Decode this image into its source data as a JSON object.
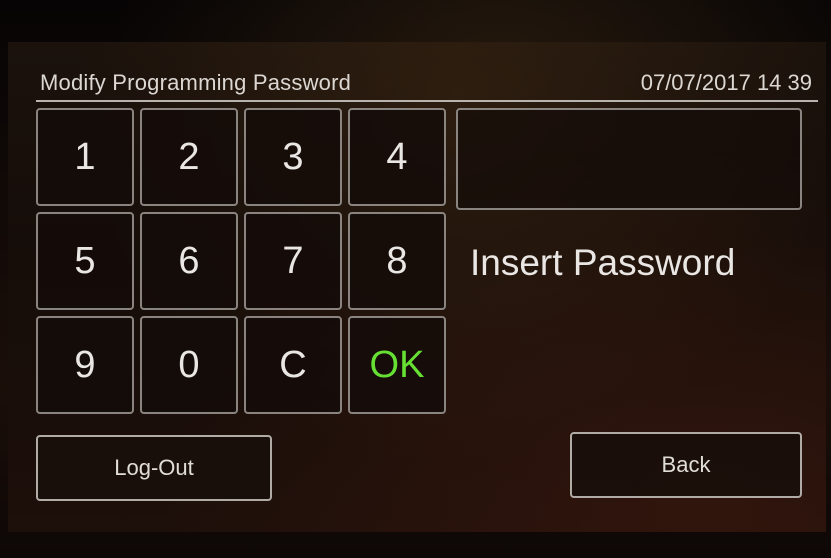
{
  "header": {
    "title": "Modify Programming Password",
    "datetime": "07/07/2017 14 39"
  },
  "keypad": {
    "keys": [
      "1",
      "2",
      "3",
      "4",
      "5",
      "6",
      "7",
      "8",
      "9",
      "0",
      "C",
      "OK"
    ]
  },
  "password_display": {
    "value": ""
  },
  "prompt": "Insert Password",
  "buttons": {
    "logout": "Log-Out",
    "back": "Back"
  },
  "colors": {
    "ok_key_text": "#66e032",
    "text": "#e9e6e3",
    "border": "#8a8480"
  }
}
